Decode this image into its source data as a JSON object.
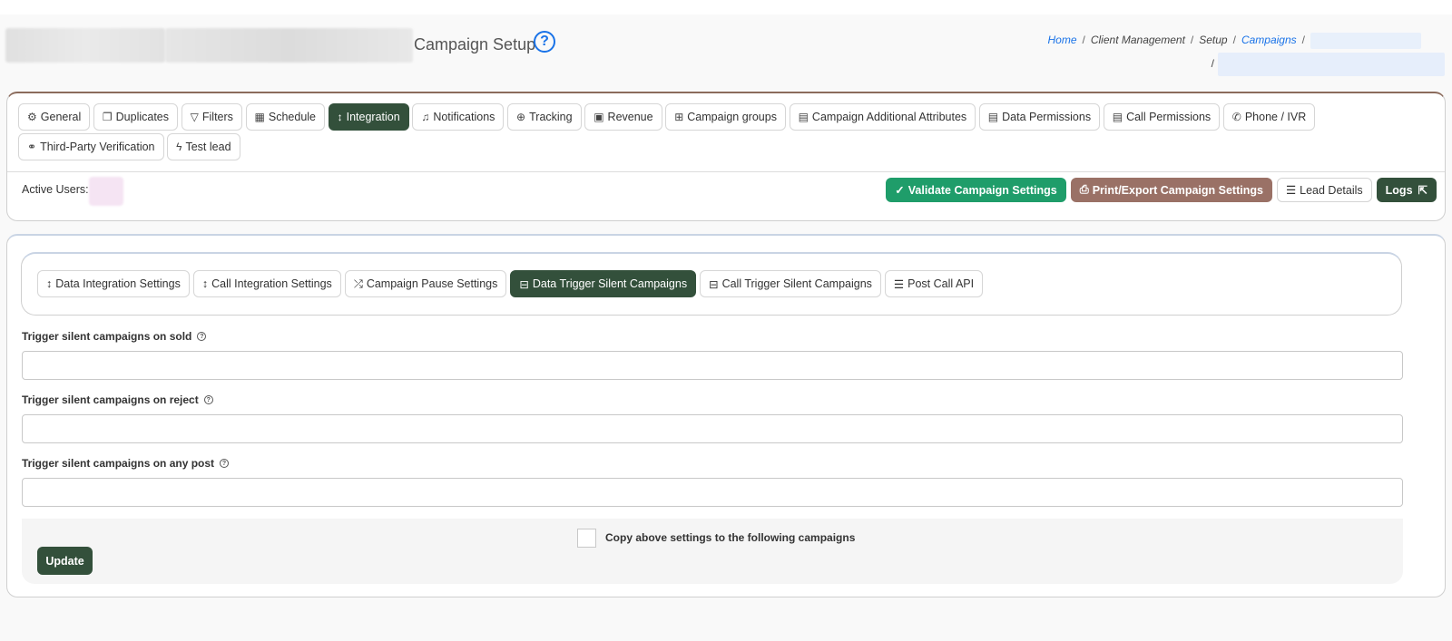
{
  "header": {
    "title": "Campaign Setup",
    "help_icon": "question-circle-icon",
    "breadcrumb": {
      "home": "Home",
      "client_management": "Client Management",
      "setup": "Setup",
      "campaigns": "Campaigns",
      "separator": "/"
    }
  },
  "tabs": [
    {
      "label": "General",
      "icon": "gears-icon"
    },
    {
      "label": "Duplicates",
      "icon": "copy-icon"
    },
    {
      "label": "Filters",
      "icon": "funnel-icon"
    },
    {
      "label": "Schedule",
      "icon": "calendar-icon"
    },
    {
      "label": "Integration",
      "icon": "arrows-vertical-icon",
      "active": true
    },
    {
      "label": "Notifications",
      "icon": "bell-icon"
    },
    {
      "label": "Tracking",
      "icon": "zoom-icon"
    },
    {
      "label": "Revenue",
      "icon": "cash-icon"
    },
    {
      "label": "Campaign groups",
      "icon": "sitemap-icon"
    },
    {
      "label": "Campaign Additional Attributes",
      "icon": "file-icon"
    },
    {
      "label": "Data Permissions",
      "icon": "file-icon"
    },
    {
      "label": "Call Permissions",
      "icon": "file-icon"
    },
    {
      "label": "Phone / IVR",
      "icon": "phone-icon"
    },
    {
      "label": "Third-Party Verification",
      "icon": "handshake-icon"
    },
    {
      "label": "Test lead",
      "icon": "lightning-icon"
    }
  ],
  "toolbar": {
    "active_users_label": "Active Users:",
    "validate_label": "Validate Campaign Settings",
    "print_label": "Print/Export Campaign Settings",
    "lead_details_label": "Lead Details",
    "logs_label": "Logs"
  },
  "subtabs": [
    {
      "label": "Data Integration Settings",
      "icon": "arrows-vertical-icon"
    },
    {
      "label": "Call Integration Settings",
      "icon": "arrows-vertical-icon"
    },
    {
      "label": "Campaign Pause Settings",
      "icon": "shuffle-icon"
    },
    {
      "label": "Data Trigger Silent Campaigns",
      "icon": "sign-icon",
      "active": true
    },
    {
      "label": "Call Trigger Silent Campaigns",
      "icon": "sign-icon"
    },
    {
      "label": "Post Call API",
      "icon": "list-icon"
    }
  ],
  "form": {
    "sold_label": "Trigger silent campaigns on sold",
    "sold_value": "",
    "reject_label": "Trigger silent campaigns on reject",
    "reject_value": "",
    "any_post_label": "Trigger silent campaigns on any post",
    "any_post_value": "",
    "copy_label": "Copy above settings to the following campaigns",
    "copy_checked": false,
    "update_label": "Update"
  },
  "colors": {
    "accent_dark_green": "#33503b",
    "validate_green": "#1f9d6a",
    "print_brown": "#9a7166",
    "link_blue": "#1a73e8"
  }
}
